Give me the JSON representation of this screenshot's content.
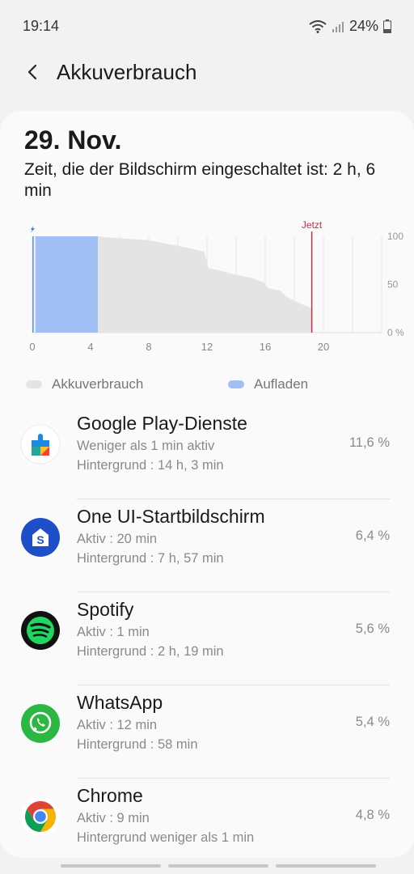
{
  "status_bar": {
    "time": "19:14",
    "battery": "24%"
  },
  "header": {
    "title": "Akkuverbrauch"
  },
  "summary": {
    "date": "29. Nov.",
    "screen_time": "Zeit, die der Bildschirm eingeschaltet ist: 2 h, 6 min"
  },
  "chart_data": {
    "type": "area",
    "x_ticks": [
      "0",
      "4",
      "8",
      "12",
      "16",
      "20"
    ],
    "y_ticks": [
      "100",
      "50",
      "0 %"
    ],
    "xlim": [
      0,
      24
    ],
    "ylim": [
      0,
      100
    ],
    "now_label": "Jetzt",
    "now_x": 19.2,
    "charging": {
      "x": [
        0,
        0.2,
        0.2,
        4.5
      ],
      "y": [
        0,
        0,
        100,
        100
      ]
    },
    "usage": {
      "x": [
        4.5,
        5,
        6,
        7,
        8,
        9,
        10,
        11,
        11.8,
        12.1,
        13,
        14,
        15,
        15.9,
        16.2,
        17,
        17.4,
        18,
        19.2
      ],
      "y": [
        100,
        99,
        98,
        97,
        96,
        93,
        90,
        87,
        84,
        67,
        64,
        60,
        57,
        52,
        46,
        44,
        38,
        33,
        25
      ]
    },
    "colors": {
      "charging": "#a1bff2",
      "usage": "#e4e4e4",
      "now": "#c0314a"
    }
  },
  "legend": {
    "usage_label": "Akkuverbrauch",
    "charging_label": "Aufladen"
  },
  "apps": [
    {
      "name": "Google Play-Dienste",
      "line1": "Weniger als 1 min aktiv",
      "line2": "Hintergrund : 14 h, 3 min",
      "percent": "11,6 %",
      "icon": "google-play-services-icon"
    },
    {
      "name": "One UI-Startbildschirm",
      "line1": "Aktiv : 20 min",
      "line2": "Hintergrund : 7 h, 57 min",
      "percent": "6,4 %",
      "icon": "one-ui-home-icon"
    },
    {
      "name": "Spotify",
      "line1": "Aktiv : 1 min",
      "line2": "Hintergrund : 2 h, 19 min",
      "percent": "5,6 %",
      "icon": "spotify-icon"
    },
    {
      "name": "WhatsApp",
      "line1": "Aktiv : 12 min",
      "line2": "Hintergrund : 58 min",
      "percent": "5,4 %",
      "icon": "whatsapp-icon"
    },
    {
      "name": "Chrome",
      "line1": "Aktiv : 9 min",
      "line2": "Hintergrund weniger als 1 min",
      "percent": "4,8 %",
      "icon": "chrome-icon"
    }
  ]
}
